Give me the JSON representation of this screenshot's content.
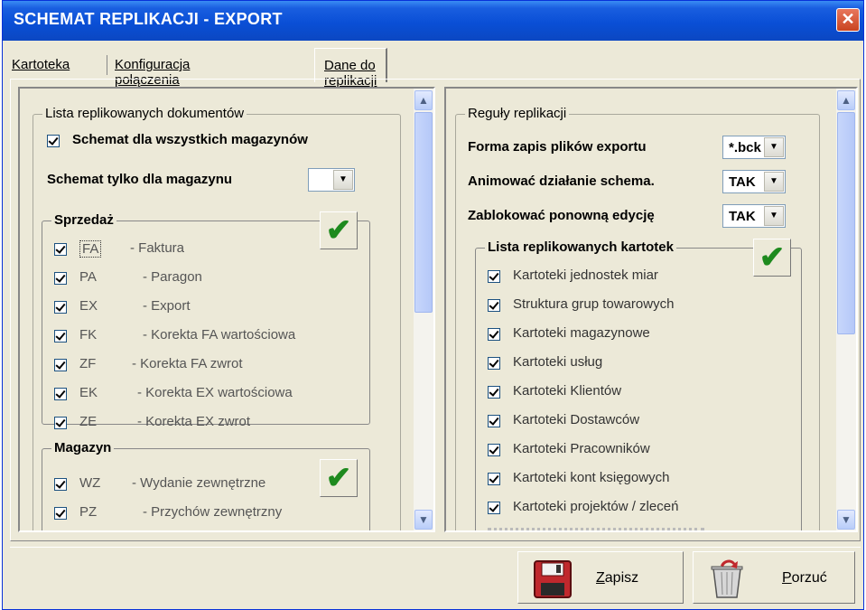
{
  "window": {
    "title": "SCHEMAT REPLIKACJI - EXPORT",
    "close_glyph": "✕"
  },
  "tabs": [
    {
      "label": "Kartoteka"
    },
    {
      "label": "Konfiguracja połączenia"
    },
    {
      "label": "Dane do replikacji",
      "active": true
    }
  ],
  "left": {
    "group_title": "Lista replikowanych dokumentów",
    "all_warehouses_label": "Schemat dla wszystkich magazynów",
    "all_warehouses_checked": true,
    "single_warehouse_label": "Schemat tylko dla magazynu",
    "single_warehouse_value": "",
    "sales": {
      "title": "Sprzedaż",
      "items": [
        {
          "code": "FA",
          "desc": "- Faktura",
          "checked": true
        },
        {
          "code": "PA",
          "desc": "- Paragon",
          "checked": true
        },
        {
          "code": "EX",
          "desc": "- Export",
          "checked": true
        },
        {
          "code": "FK",
          "desc": "- Korekta FA wartościowa",
          "checked": true
        },
        {
          "code": "ZF",
          "desc": "- Korekta FA zwrot",
          "checked": true
        },
        {
          "code": "EK",
          "desc": "- Korekta EX wartościowa",
          "checked": true
        },
        {
          "code": "ZE",
          "desc": "- Korekta EX zwrot",
          "checked": true
        }
      ]
    },
    "warehouse": {
      "title": "Magazyn",
      "items": [
        {
          "code": "WZ",
          "desc": "- Wydanie zewnętrzne",
          "checked": true
        },
        {
          "code": "PZ",
          "desc": "- Przychów zewnętrzny",
          "checked": true
        }
      ]
    }
  },
  "right": {
    "group_title": "Reguły replikacji",
    "rules": [
      {
        "label": "Forma zapis plików exportu",
        "value": "*.bck"
      },
      {
        "label": "Animować działanie schema.",
        "value": "TAK"
      },
      {
        "label": "Zablokować ponowną edycję",
        "value": "TAK"
      }
    ],
    "catalogs": {
      "title": "Lista replikowanych kartotek",
      "items": [
        {
          "label": "Kartoteki jednostek miar",
          "checked": true
        },
        {
          "label": "Struktura grup towarowych",
          "checked": true
        },
        {
          "label": "Kartoteki magazynowe",
          "checked": true
        },
        {
          "label": "Kartoteki usług",
          "checked": true
        },
        {
          "label": "Kartoteki Klientów",
          "checked": true
        },
        {
          "label": "Kartoteki Dostawców",
          "checked": true
        },
        {
          "label": "Kartoteki Pracowników",
          "checked": true
        },
        {
          "label": "Kartoteki kont księgowych",
          "checked": true
        },
        {
          "label": "Kartoteki projektów / zleceń",
          "checked": true
        }
      ]
    }
  },
  "buttons": {
    "save_label": "Zapisz",
    "cancel_label": "Porzuć"
  },
  "colors": {
    "title_bar": "#0a4fd6",
    "check_green": "#1e8a1e",
    "save_icon": "#c0282d"
  }
}
